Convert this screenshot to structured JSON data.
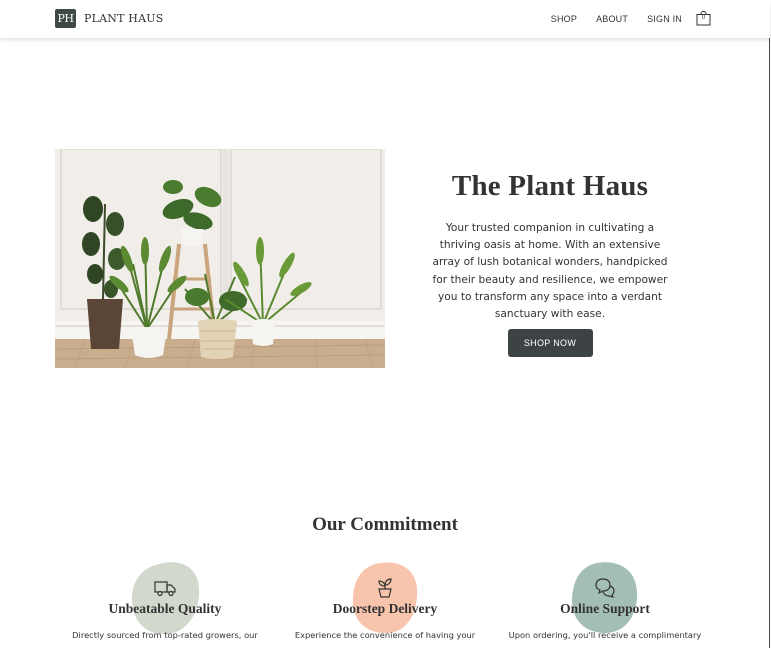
{
  "header": {
    "logo_mark": "PH",
    "logo_text": "PLANT HAUS",
    "nav": [
      {
        "label": "SHOP"
      },
      {
        "label": "ABOUT"
      },
      {
        "label": "SIGN IN"
      }
    ],
    "cart_count": "0"
  },
  "hero": {
    "title": "The Plant Haus",
    "description": "Your trusted companion in cultivating a thriving oasis at home. With an extensive array of lush botanical wonders, handpicked for their beauty and resilience, we empower you to transform any space into a verdant sanctuary with ease.",
    "button_label": "SHOP NOW"
  },
  "commitment": {
    "title": "Our Commitment",
    "features": [
      {
        "title": "Unbeatable Quality",
        "desc": "Directly sourced from top-rated growers, our",
        "icon": "truck-icon",
        "blob_color": "#d3d8cd"
      },
      {
        "title": "Doorstep Delivery",
        "desc": "Experience the convenience of having your",
        "icon": "plant-icon",
        "blob_color": "#f8c4ac"
      },
      {
        "title": "Online Support",
        "desc": "Upon ordering, you'll receive a complimentary",
        "icon": "chat-icon",
        "blob_color": "#a3bfb3"
      }
    ]
  }
}
